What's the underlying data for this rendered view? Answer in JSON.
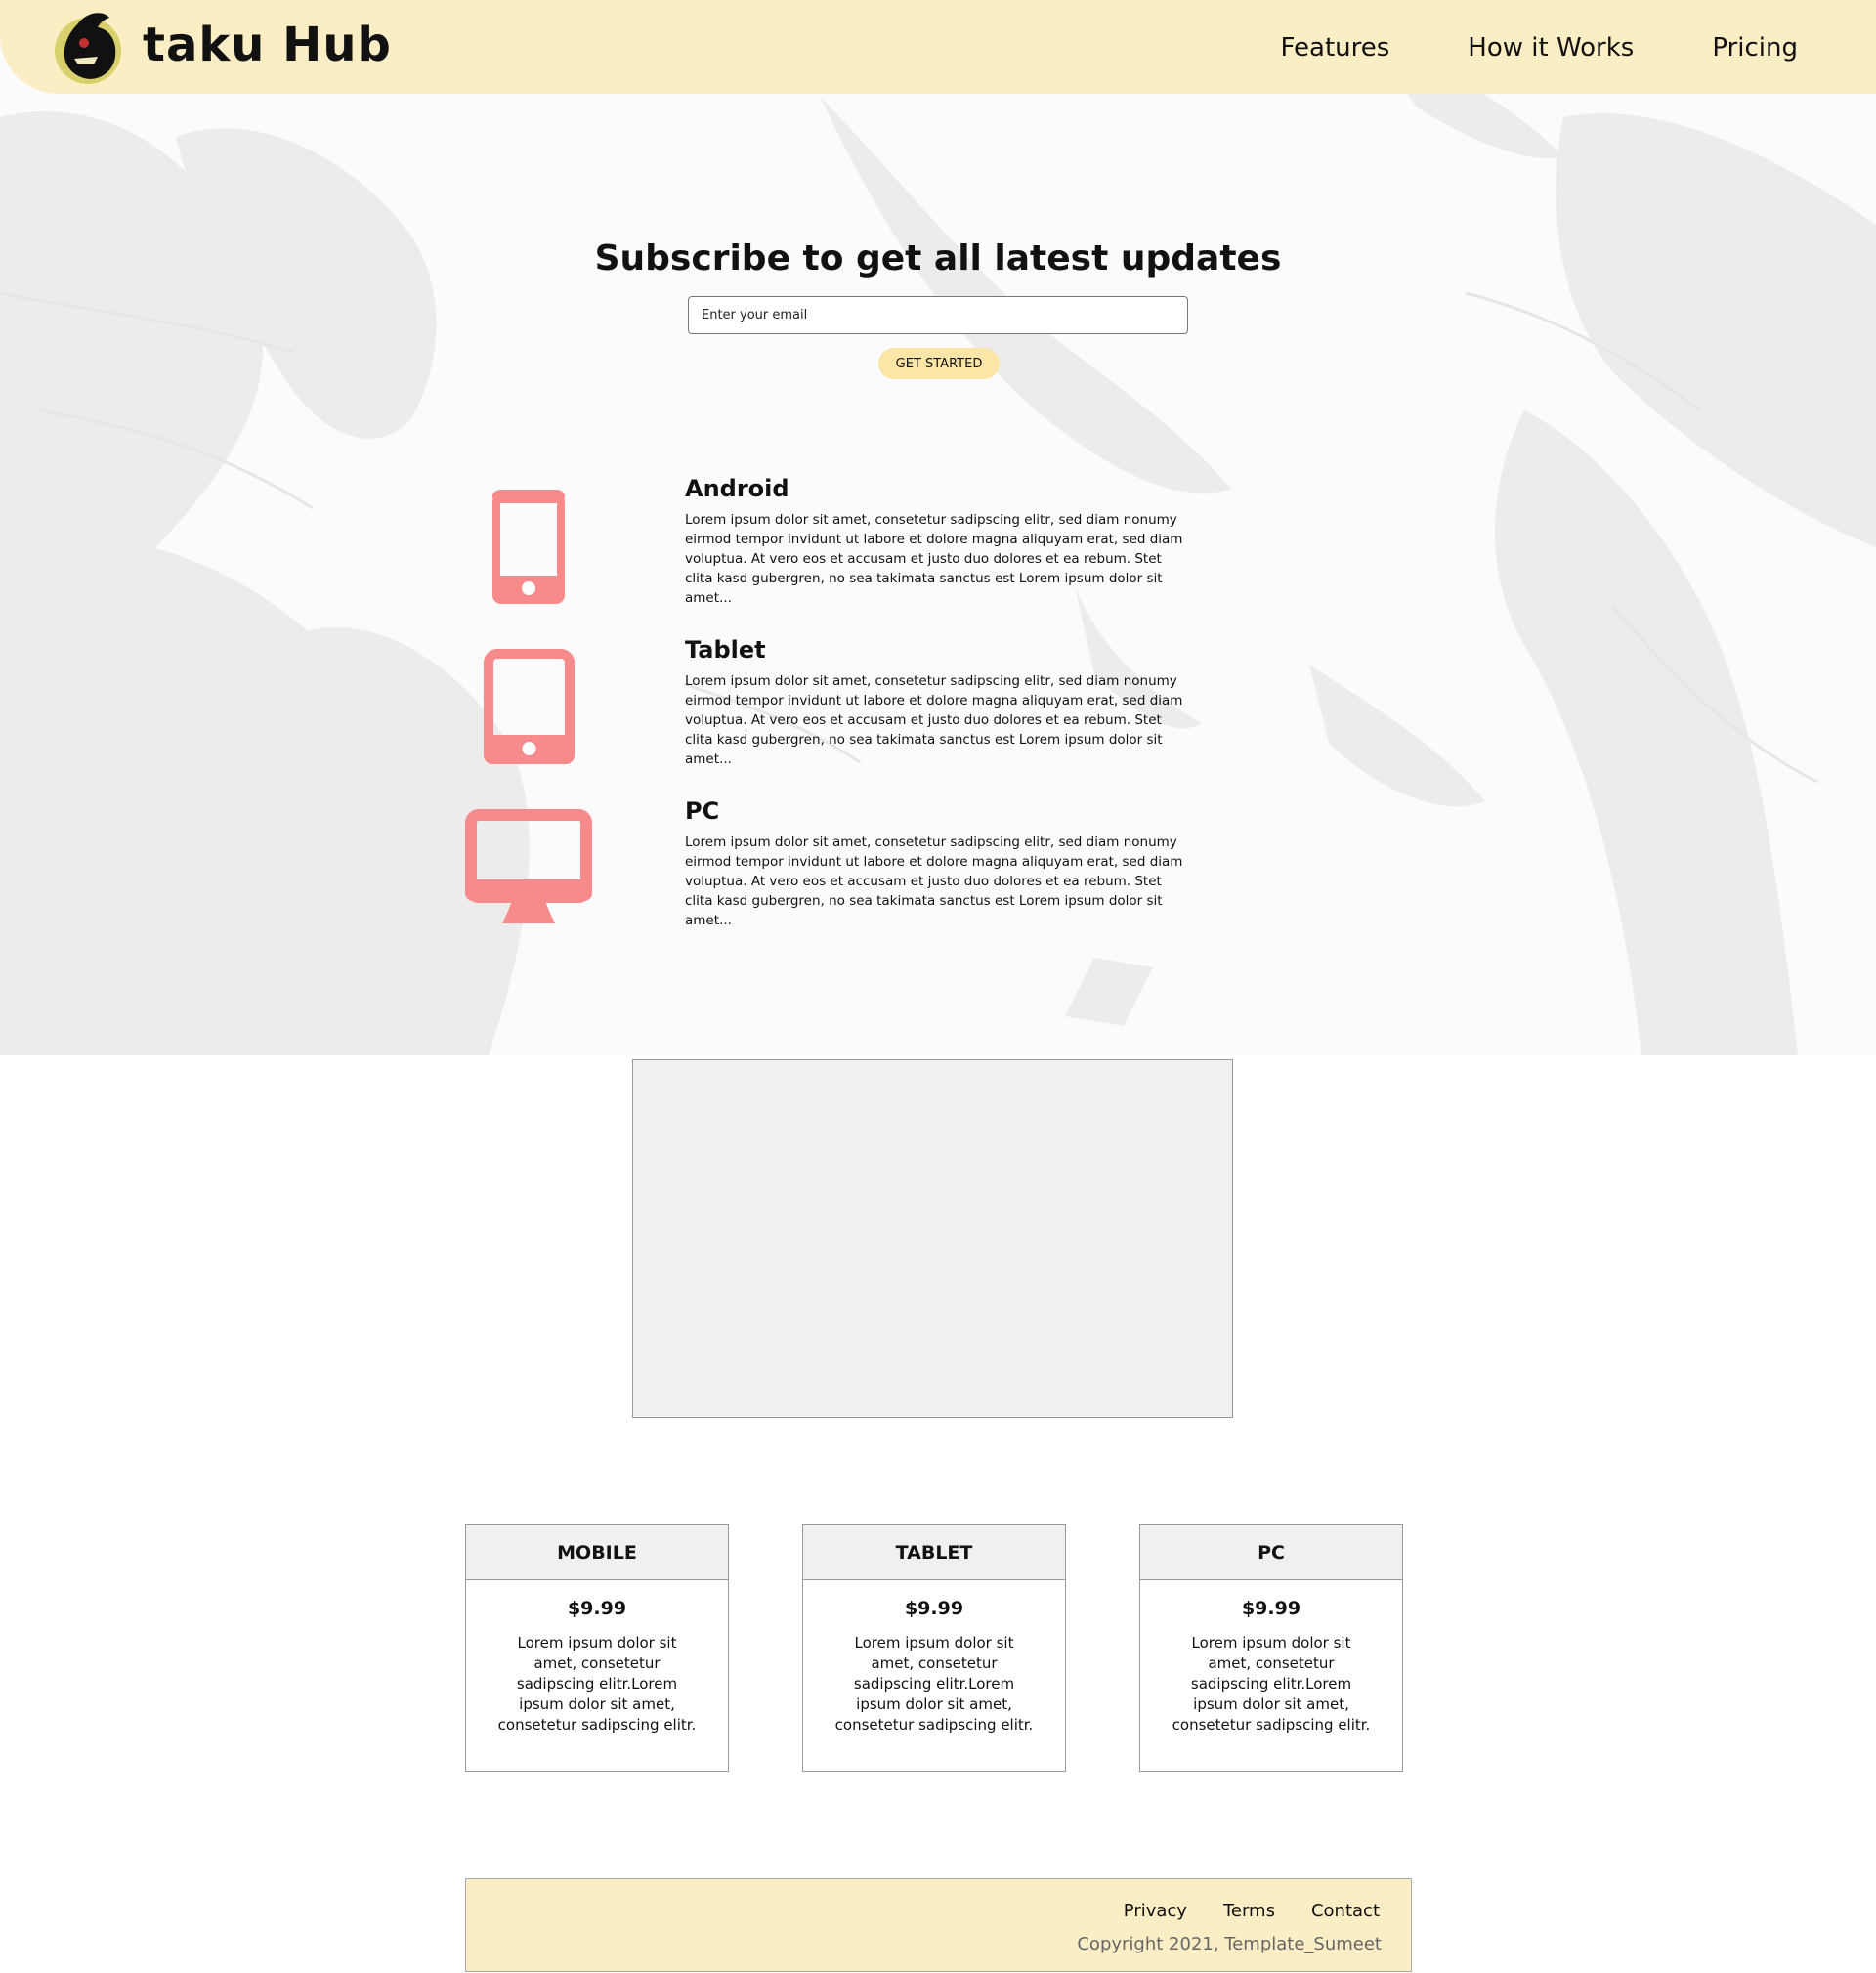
{
  "header": {
    "brand": "taku Hub",
    "nav": [
      "Features",
      "How it Works",
      "Pricing"
    ]
  },
  "subscribe": {
    "title": "Subscribe to get all latest updates",
    "email_placeholder": "Enter your email",
    "button_label": "GET STARTED"
  },
  "features": [
    {
      "icon": "phone-icon",
      "title": "Android",
      "text": "Lorem ipsum dolor sit amet, consetetur sadipscing elitr, sed diam nonumy eirmod tempor invidunt ut labore et dolore magna aliquyam erat, sed diam voluptua. At vero eos et accusam et justo duo dolores et ea rebum. Stet clita kasd gubergren, no sea takimata sanctus est Lorem ipsum dolor sit amet..."
    },
    {
      "icon": "tablet-icon",
      "title": "Tablet",
      "text": "Lorem ipsum dolor sit amet, consetetur sadipscing elitr, sed diam nonumy eirmod tempor invidunt ut labore et dolore magna aliquyam erat, sed diam voluptua. At vero eos et accusam et justo duo dolores et ea rebum. Stet clita kasd gubergren, no sea takimata sanctus est Lorem ipsum dolor sit amet..."
    },
    {
      "icon": "monitor-icon",
      "title": "PC",
      "text": "Lorem ipsum dolor sit amet, consetetur sadipscing elitr, sed diam nonumy eirmod tempor invidunt ut labore et dolore magna aliquyam erat, sed diam voluptua. At vero eos et accusam et justo duo dolores et ea rebum. Stet clita kasd gubergren, no sea takimata sanctus est Lorem ipsum dolor sit amet..."
    }
  ],
  "pricing": [
    {
      "name": "MOBILE",
      "price": "$9.99",
      "description": "Lorem ipsum dolor sit amet, consetetur sadipscing elitr.Lorem ipsum dolor sit amet, consetetur sadipscing elitr."
    },
    {
      "name": "TABLET",
      "price": "$9.99",
      "description": "Lorem ipsum dolor sit amet, consetetur sadipscing elitr.Lorem ipsum dolor sit amet, consetetur sadipscing elitr."
    },
    {
      "name": "PC",
      "price": "$9.99",
      "description": "Lorem ipsum dolor sit amet, consetetur sadipscing elitr.Lorem ipsum dolor sit amet, consetetur sadipscing elitr."
    }
  ],
  "footer": {
    "links": [
      "Privacy",
      "Terms",
      "Contact"
    ],
    "copyright": "Copyright 2021, Template_Sumeet"
  },
  "colors": {
    "header_bg": "#fbedc4",
    "accent": "#fbe6a8",
    "icon_color": "#f78b8b",
    "panel_bg": "#f1f0f0"
  }
}
